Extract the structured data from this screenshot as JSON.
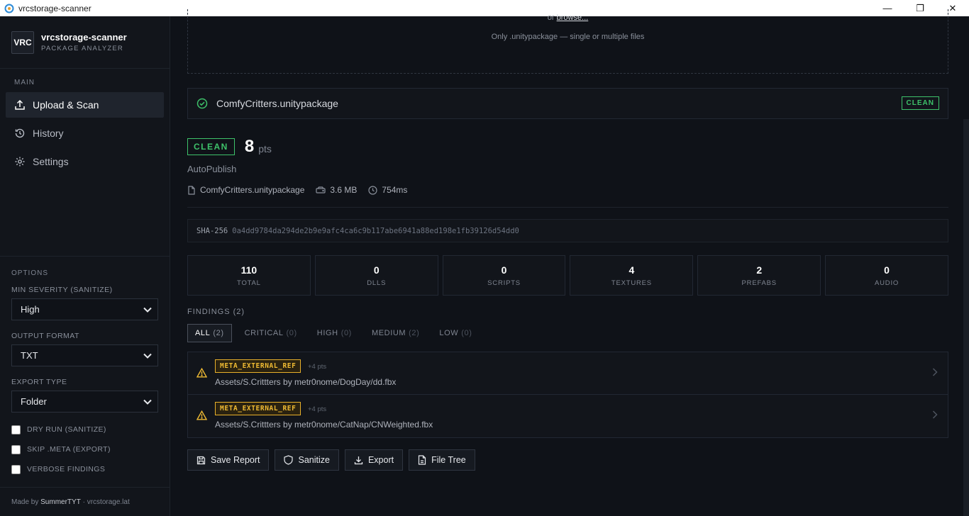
{
  "window": {
    "title": "vrcstorage-scanner",
    "buttons": [
      "—",
      "❐",
      "✕"
    ]
  },
  "brand": {
    "logo_text": "VRC",
    "name": "vrcstorage-scanner",
    "subtitle": "PACKAGE ANALYZER"
  },
  "sidebar": {
    "section_main": "MAIN",
    "items": [
      {
        "label": "Upload & Scan",
        "icon": "upload-icon",
        "active": true
      },
      {
        "label": "History",
        "icon": "history-icon",
        "active": false
      },
      {
        "label": "Settings",
        "icon": "gear-icon",
        "active": false
      }
    ],
    "options_title": "OPTIONS",
    "min_severity": {
      "label": "MIN SEVERITY (SANITIZE)",
      "value": "High"
    },
    "output_format": {
      "label": "OUTPUT FORMAT",
      "value": "TXT"
    },
    "export_type": {
      "label": "EXPORT TYPE",
      "value": "Folder"
    },
    "checkboxes": [
      {
        "label": "DRY RUN (SANITIZE)",
        "checked": false
      },
      {
        "label": "SKIP .META (EXPORT)",
        "checked": false
      },
      {
        "label": "VERBOSE FINDINGS",
        "checked": false
      }
    ],
    "footer": {
      "prefix": "Made by",
      "author": "SummerTYT",
      "sep": "·",
      "site": "vrcstorage.lat"
    }
  },
  "dropzone": {
    "browse_prefix": "or",
    "browse_link": "browse...",
    "hint": "Only .unitypackage — single or multiple files"
  },
  "file": {
    "name": "ComfyCritters.unitypackage",
    "status": "CLEAN"
  },
  "result": {
    "verdict": "CLEAN",
    "score": "8",
    "score_unit": "pts",
    "publisher": "AutoPublish",
    "filename": "ComfyCritters.unitypackage",
    "size": "3.6 MB",
    "duration": "754ms",
    "sha_label": "SHA-256",
    "sha_value": "0a4dd9784da294de2b9e9afc4ca6c9b117abe6941a88ed198e1fb39126d54dd0"
  },
  "stats": [
    {
      "value": "110",
      "label": "TOTAL"
    },
    {
      "value": "0",
      "label": "DLLS"
    },
    {
      "value": "0",
      "label": "SCRIPTS"
    },
    {
      "value": "4",
      "label": "TEXTURES"
    },
    {
      "value": "2",
      "label": "PREFABS"
    },
    {
      "value": "0",
      "label": "AUDIO"
    }
  ],
  "findings": {
    "title": "FINDINGS (2)",
    "tabs": [
      {
        "label": "ALL",
        "count": "(2)",
        "active": true
      },
      {
        "label": "CRITICAL",
        "count": "(0)",
        "active": false
      },
      {
        "label": "HIGH",
        "count": "(0)",
        "active": false
      },
      {
        "label": "MEDIUM",
        "count": "(2)",
        "active": false
      },
      {
        "label": "LOW",
        "count": "(0)",
        "active": false
      }
    ],
    "items": [
      {
        "rule": "META_EXTERNAL_REF",
        "points": "+4 pts",
        "path": "Assets/S.Crittters by metr0nome/DogDay/dd.fbx"
      },
      {
        "rule": "META_EXTERNAL_REF",
        "points": "+4 pts",
        "path": "Assets/S.Crittters by metr0nome/CatNap/CNWeighted.fbx"
      }
    ]
  },
  "actions": [
    {
      "label": "Save Report",
      "icon": "save-icon"
    },
    {
      "label": "Sanitize",
      "icon": "shield-icon"
    },
    {
      "label": "Export",
      "icon": "download-icon"
    },
    {
      "label": "File Tree",
      "icon": "file-icon"
    }
  ],
  "colors": {
    "clean": "#3ec26a",
    "warning": "#f0bb33",
    "bg": "#0f1218",
    "panel": "#12151b"
  }
}
